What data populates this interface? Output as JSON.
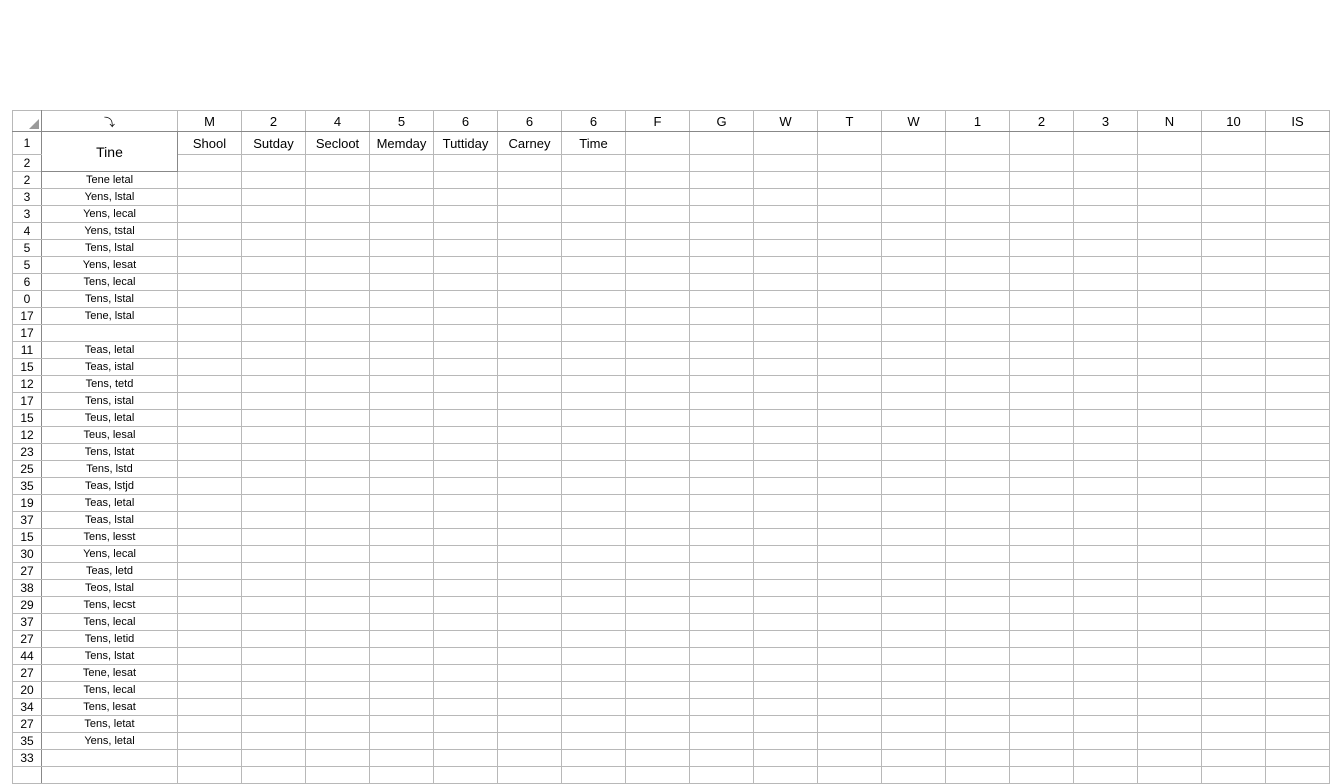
{
  "columnHeaders": [
    "⤵",
    "M",
    "2",
    "4",
    "5",
    "6",
    "6",
    "6",
    "F",
    "G",
    "W",
    "T",
    "W",
    "1",
    "2",
    "3",
    "N",
    "10",
    "IS"
  ],
  "titleCell": "Tine",
  "subHeaders": [
    "Shool",
    "Sutday",
    "Secloot",
    "Memday",
    "Tuttiday",
    "Carney",
    "Time",
    "",
    "",
    "",
    "",
    "",
    "",
    "",
    "",
    "",
    "",
    ""
  ],
  "rows": [
    {
      "num": "1",
      "label": "",
      "isTitle": true
    },
    {
      "num": "2",
      "label": "",
      "isSub": true
    },
    {
      "num": "2",
      "label": "Tene  letal"
    },
    {
      "num": "3",
      "label": "Yens,  lstal"
    },
    {
      "num": "3",
      "label": "Yens,  lecal"
    },
    {
      "num": "4",
      "label": "Yens,  tstal"
    },
    {
      "num": "5",
      "label": "Tens,  lstal"
    },
    {
      "num": "5",
      "label": "Yens,  lesat"
    },
    {
      "num": "6",
      "label": "Tens,  lecal"
    },
    {
      "num": "0",
      "label": "Tens,  lstal"
    },
    {
      "num": "17",
      "label": "Tene,  lstal"
    },
    {
      "num": "17",
      "label": ""
    },
    {
      "num": "11",
      "label": "Teas,  letal"
    },
    {
      "num": "15",
      "label": "Teas,  istal"
    },
    {
      "num": "12",
      "label": "Tens,  tetd"
    },
    {
      "num": "17",
      "label": "Tens,  istal"
    },
    {
      "num": "15",
      "label": "Teus,  letal"
    },
    {
      "num": "12",
      "label": "Teus,  lesal"
    },
    {
      "num": "23",
      "label": "Tens,  lstat"
    },
    {
      "num": "25",
      "label": "Tens,  lstd"
    },
    {
      "num": "35",
      "label": "Teas,  lstjd"
    },
    {
      "num": "19",
      "label": "Teas,  letal"
    },
    {
      "num": "37",
      "label": "Teas,  lstal"
    },
    {
      "num": "15",
      "label": "Tens,  lesst"
    },
    {
      "num": "30",
      "label": "Yens,  lecal"
    },
    {
      "num": "27",
      "label": "Teas,  letd"
    },
    {
      "num": "38",
      "label": "Teos,  lstal"
    },
    {
      "num": "29",
      "label": "Tens,  lecst"
    },
    {
      "num": "37",
      "label": "Tens,  lecal"
    },
    {
      "num": "27",
      "label": "Tens,  letid"
    },
    {
      "num": "44",
      "label": "Tens,  lstat"
    },
    {
      "num": "27",
      "label": "Tene,  lesat"
    },
    {
      "num": "20",
      "label": "Tens,  lecal"
    },
    {
      "num": "34",
      "label": "Tens,  lesat"
    },
    {
      "num": "27",
      "label": "Tens,  letat"
    },
    {
      "num": "35",
      "label": "Yens,  letal"
    },
    {
      "num": "33",
      "label": ""
    },
    {
      "num": "",
      "label": ""
    }
  ],
  "numDataCols": 18
}
